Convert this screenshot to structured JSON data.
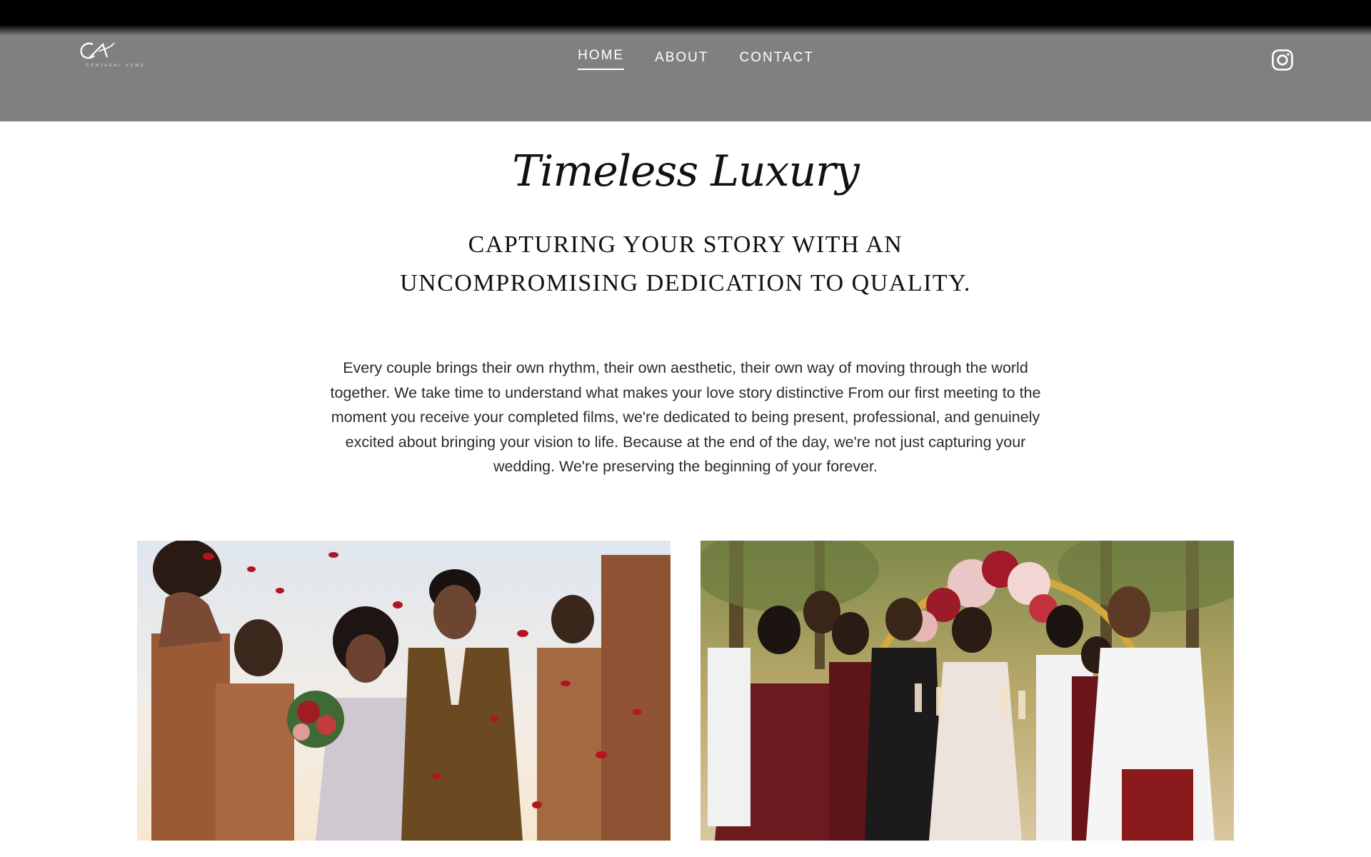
{
  "header": {
    "logo_mark": "CV",
    "logo_text": "CONJUGAL VOWS",
    "nav": [
      {
        "label": "HOME",
        "active": true
      },
      {
        "label": "ABOUT",
        "active": false
      },
      {
        "label": "CONTACT",
        "active": false
      }
    ],
    "social_icon": "instagram-icon"
  },
  "hero": {
    "script_title": "Timeless Luxury",
    "subtitle_line1": "CAPTURING YOUR STORY WITH AN",
    "subtitle_line2": "UNCOMPROMISING DEDICATION TO QUALITY.",
    "body": "Every couple brings their own rhythm, their own aesthetic, their own way of moving through the world together. We take time to understand what makes your love story distinctive From our first meeting to the moment you receive your completed films, we're dedicated to being present, professional, and genuinely excited about bringing your vision to life. Because at the end of the day, we're not just capturing your wedding. We're preserving the beginning of your forever."
  },
  "photos": [
    {
      "subject": "wedding party tossing rose petals over bride and groom"
    },
    {
      "subject": "wedding party toasting with champagne in front of floral arch"
    }
  ],
  "colors": {
    "header_bg": "#808080",
    "page_bg": "#ffffff",
    "text_dark": "#111111",
    "body_text": "#2b2b2b"
  }
}
